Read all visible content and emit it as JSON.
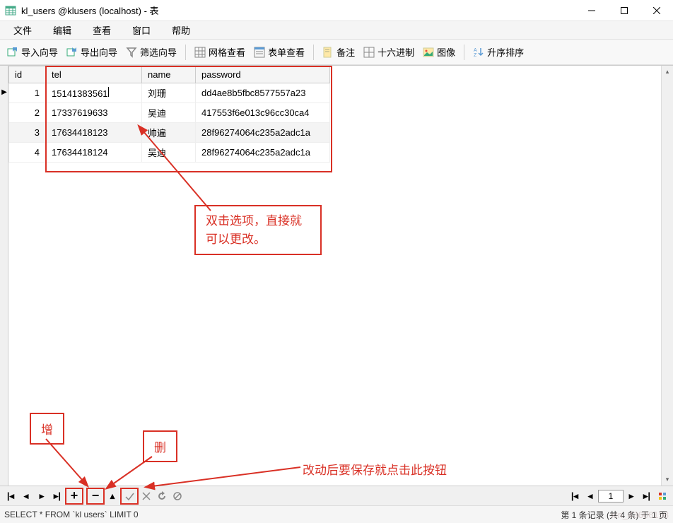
{
  "title": "kl_users @klusers (localhost) - 表",
  "menu": {
    "file": "文件",
    "edit": "编辑",
    "view": "查看",
    "window": "窗口",
    "help": "帮助"
  },
  "toolbar": {
    "import": "导入向导",
    "export": "导出向导",
    "filter": "筛选向导",
    "grid": "网格查看",
    "form": "表单查看",
    "memo": "备注",
    "hex": "十六进制",
    "image": "图像",
    "sort": "升序排序"
  },
  "columns": {
    "id": "id",
    "tel": "tel",
    "name": "name",
    "password": "password"
  },
  "rows": [
    {
      "id": "1",
      "tel": "15141383561",
      "name": "刘珊",
      "password": "dd4ae8b5fbc8577557a23"
    },
    {
      "id": "2",
      "tel": "17337619633",
      "name": "吴迪",
      "password": "417553f6e013c96cc30ca4"
    },
    {
      "id": "3",
      "tel": "17634418123",
      "name": "帅遍",
      "password": "28f96274064c235a2adc1a"
    },
    {
      "id": "4",
      "tel": "17634418124",
      "name": "吴迪",
      "password": "28f96274064c235a2adc1a"
    }
  ],
  "nav": {
    "page": "1"
  },
  "status": {
    "sql": "SELECT * FROM `kl users` LIMIT 0",
    "records": "第 1 条记录 (共 4 条) 于 1 页"
  },
  "annotations": {
    "dblclick": "双击选项，直接就可以更改。",
    "add": "增",
    "del": "删",
    "save": "改动后要保存就点击此按钮"
  },
  "watermark": "xin_43606158"
}
